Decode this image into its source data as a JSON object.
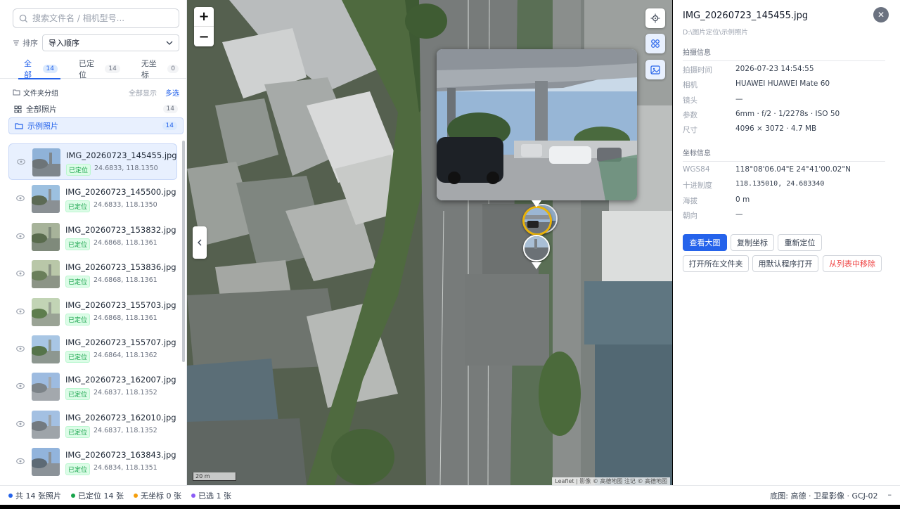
{
  "search": {
    "placeholder": "搜索文件名 / 相机型号..."
  },
  "sort": {
    "label": "排序",
    "value": "导入顺序"
  },
  "tabs": [
    {
      "label": "全部",
      "count": "14"
    },
    {
      "label": "已定位",
      "count": "14"
    },
    {
      "label": "无坐标",
      "count": "0"
    }
  ],
  "groups": {
    "title": "文件夹分组",
    "show_all": "全部显示",
    "multi_select": "多选",
    "items": [
      {
        "label": "全部照片",
        "count": "14"
      },
      {
        "label": "示例照片",
        "count": "14"
      }
    ]
  },
  "photos": [
    {
      "name": "IMG_20260723_145455.jpg",
      "status": "已定位",
      "coord": "24.6833, 118.1350"
    },
    {
      "name": "IMG_20260723_145500.jpg",
      "status": "已定位",
      "coord": "24.6833, 118.1350"
    },
    {
      "name": "IMG_20260723_153832.jpg",
      "status": "已定位",
      "coord": "24.6868, 118.1361"
    },
    {
      "name": "IMG_20260723_153836.jpg",
      "status": "已定位",
      "coord": "24.6868, 118.1361"
    },
    {
      "name": "IMG_20260723_155703.jpg",
      "status": "已定位",
      "coord": "24.6868, 118.1361"
    },
    {
      "name": "IMG_20260723_155707.jpg",
      "status": "已定位",
      "coord": "24.6864, 118.1362"
    },
    {
      "name": "IMG_20260723_162007.jpg",
      "status": "已定位",
      "coord": "24.6837, 118.1352"
    },
    {
      "name": "IMG_20260723_162010.jpg",
      "status": "已定位",
      "coord": "24.6837, 118.1352"
    },
    {
      "name": "IMG_20260723_163843.jpg",
      "status": "已定位",
      "coord": "24.6834, 118.1351"
    }
  ],
  "map": {
    "zoom_in": "+",
    "zoom_out": "−",
    "scale": "20 m",
    "attribution": "Leaflet | 影像 © 高德地图 注记 © 高德地图"
  },
  "detail": {
    "title": "IMG_20260723_145455.jpg",
    "path": "D:\\图片定位\\示例照片",
    "close": "✕",
    "shoot_section": "拍摄信息",
    "shoot": [
      {
        "k": "拍摄时间",
        "v": "2026-07-23 14:54:55"
      },
      {
        "k": "相机",
        "v": "HUAWEI HUAWEI Mate 60"
      },
      {
        "k": "镜头",
        "v": "—"
      },
      {
        "k": "参数",
        "v": "6mm · f/2 · 1/2278s · ISO 50"
      },
      {
        "k": "尺寸",
        "v": "4096 × 3072 · 4.7 MB"
      }
    ],
    "coord_section": "坐标信息",
    "coords": [
      {
        "k": "WGS84",
        "v": "118°08'06.04\"E 24°41'00.02\"N"
      },
      {
        "k": "十进制度",
        "v": "118.135010, 24.683340"
      },
      {
        "k": "海拔",
        "v": "0 m"
      },
      {
        "k": "朝向",
        "v": "—"
      }
    ],
    "buttons": {
      "view_large": "查看大图",
      "copy_coords": "复制坐标",
      "relocate": "重新定位",
      "open_folder": "打开所在文件夹",
      "open_default": "用默认程序打开",
      "remove": "从列表中移除"
    }
  },
  "status": {
    "total": "共 14 张照片",
    "located": "已定位 14 张",
    "no_coord": "无坐标 0 张",
    "selected": "已选 1 张",
    "basemap": "底图: 高德 · 卫星影像 · GCJ-02",
    "extra": "–"
  },
  "colors": {
    "accent": "#2563eb",
    "located": "#16a34a",
    "no_coord": "#f59e0b",
    "selected": "#8b5cf6",
    "danger": "#ef4444"
  }
}
